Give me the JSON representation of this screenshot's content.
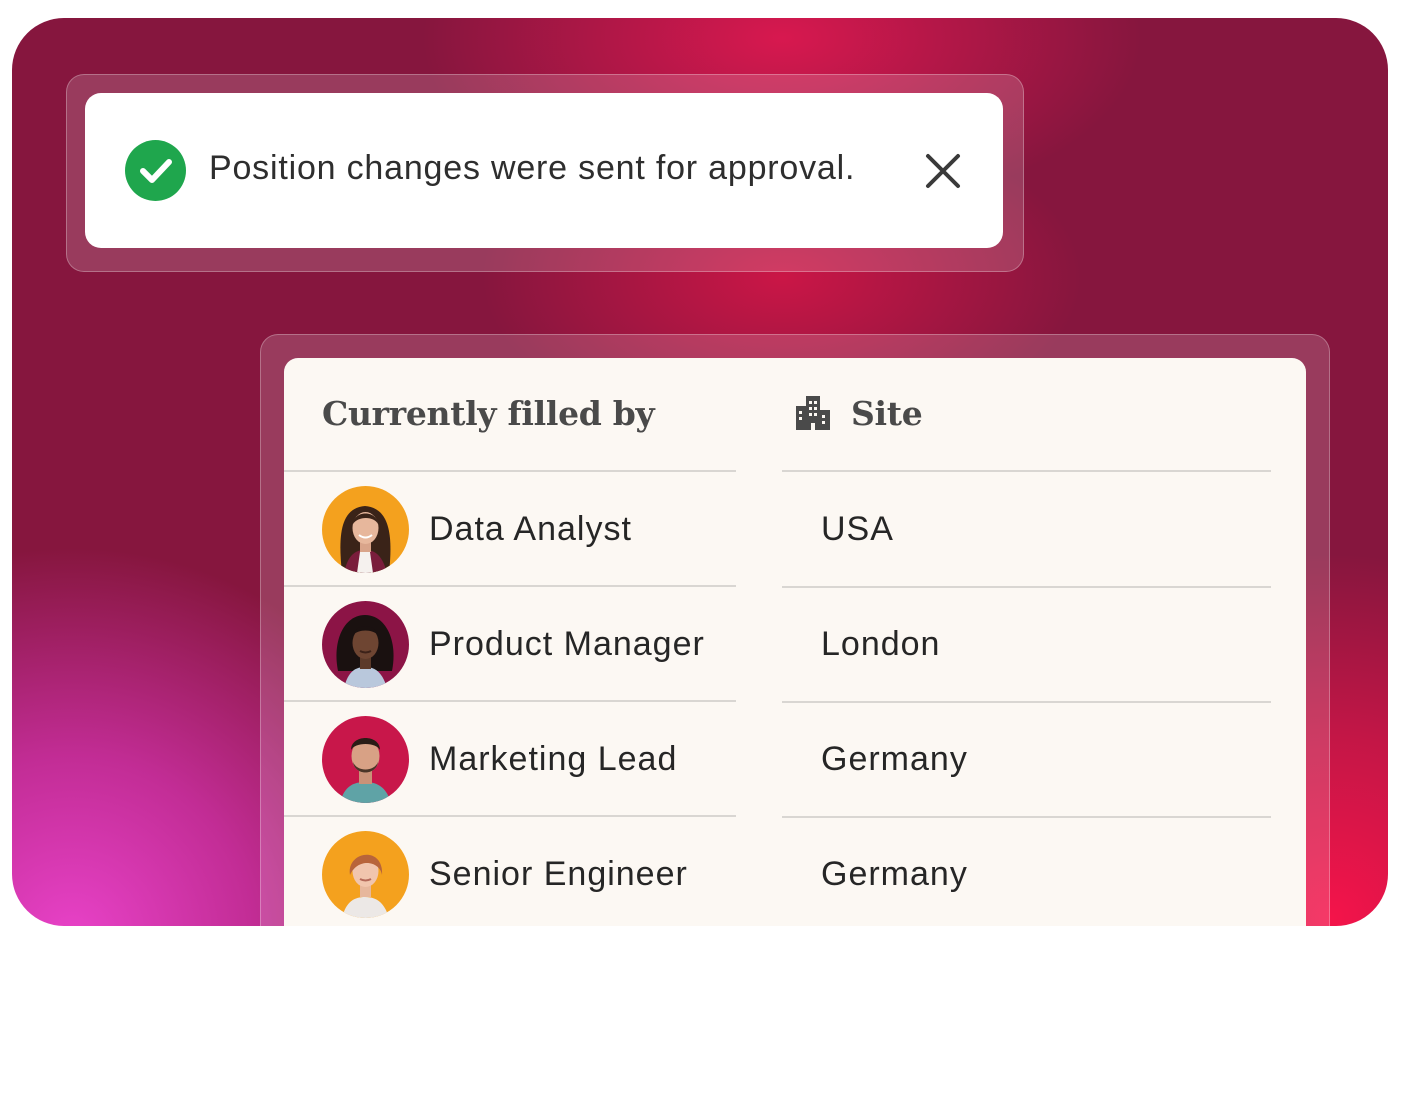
{
  "toast": {
    "message": "Position changes were sent for approval.",
    "status_icon": "check-circle-icon",
    "close_icon": "close-icon",
    "status_color": "#1fa64d"
  },
  "table": {
    "headers": {
      "filled_by": "Currently filled by",
      "site": "Site",
      "site_icon": "building-icon"
    },
    "rows": [
      {
        "role": "Data Analyst",
        "site": "USA",
        "avatar_bg": "#f4a11e"
      },
      {
        "role": "Product Manager",
        "site": "London",
        "avatar_bg": "#8c1446"
      },
      {
        "role": "Marketing Lead",
        "site": "Germany",
        "avatar_bg": "#c8174a"
      },
      {
        "role": "Senior Engineer",
        "site": "Germany",
        "avatar_bg": "#f4a11e"
      }
    ]
  },
  "colors": {
    "backdrop": "#86163e",
    "card": "#fcf8f3",
    "accent_pink": "#e8147a"
  }
}
